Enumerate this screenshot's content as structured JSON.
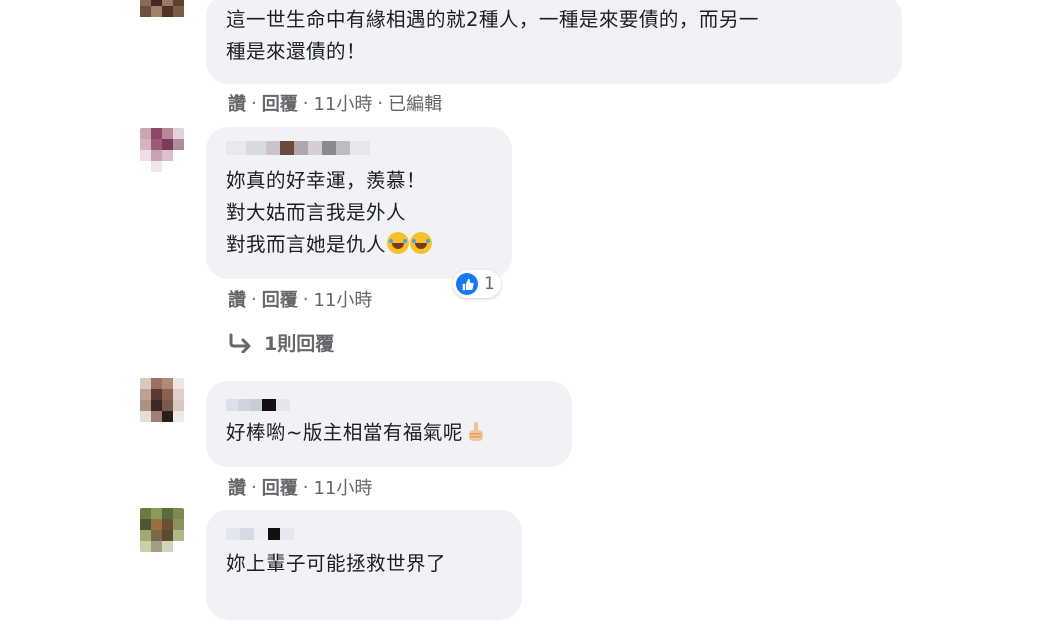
{
  "comments": [
    {
      "text": "這一世生命中有緣相遇的就2種人，一種是來要債的，而另一\n種是來還債的！",
      "actions": {
        "like": "讚",
        "reply": "回覆",
        "time": "11小時",
        "edited": "已編輯"
      }
    },
    {
      "text": "妳真的好幸運，羨慕！\n對大姑而言我是外人\n對我而言她是仇人",
      "emojis": [
        "rolling-on-floor-laughing-emoji",
        "rolling-on-floor-laughing-emoji"
      ],
      "reaction": {
        "icon": "like-icon",
        "count": "1"
      },
      "actions": {
        "like": "讚",
        "reply": "回覆",
        "time": "11小時"
      },
      "replies_label": "1則回覆"
    },
    {
      "text": "好棒喲~版主相當有福氣呢",
      "emojis": [
        "thumbs-up-emoji"
      ],
      "actions": {
        "like": "讚",
        "reply": "回覆",
        "time": "11小時"
      }
    },
    {
      "text": "妳上輩子可能拯救世界了"
    }
  ],
  "separator": "·",
  "colors": {
    "bubble": "#f0f2f5",
    "meta": "#65676b",
    "like_blue": "#1877f2"
  }
}
